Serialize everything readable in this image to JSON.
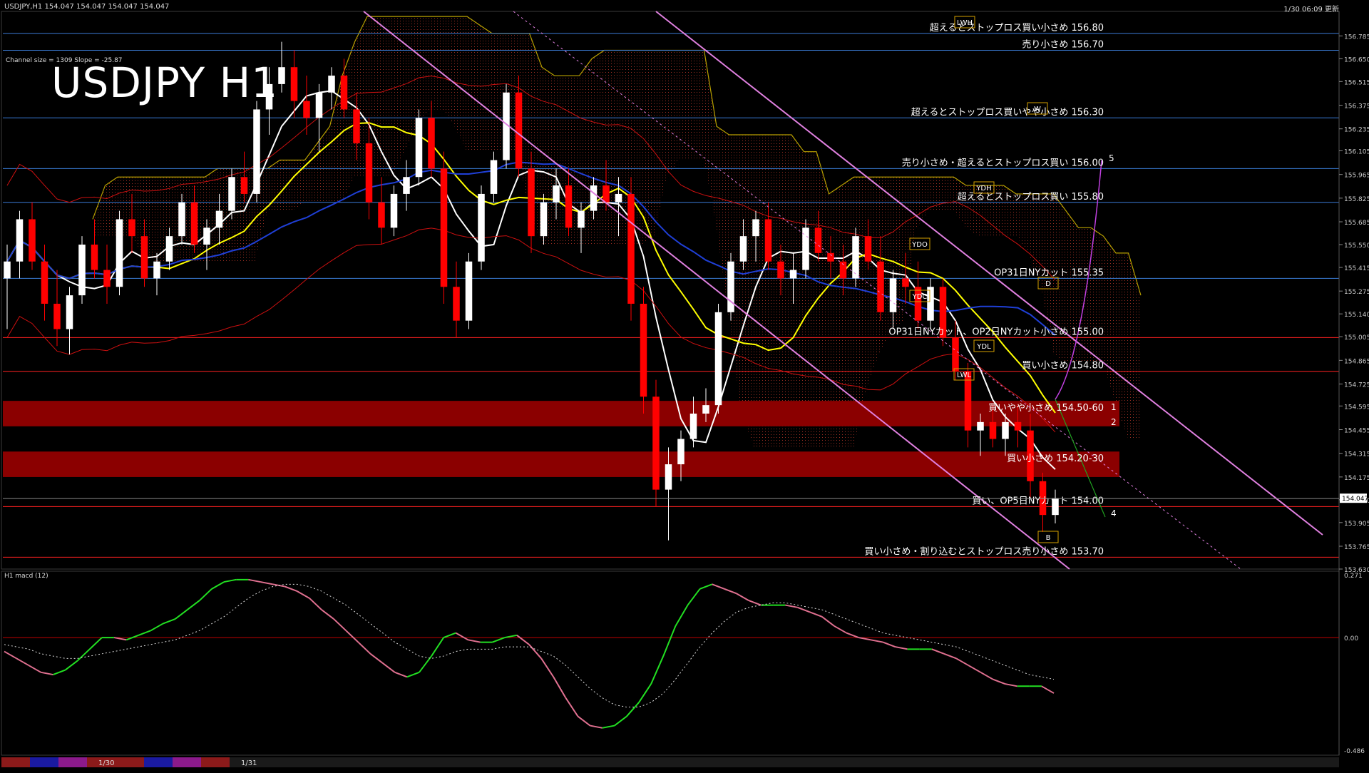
{
  "header": {
    "symbol_line": "USDJPY,H1  154.047 154.047 154.047 154.047",
    "channel_info": "Channel size = 1309 Slope = -25.87",
    "big_title": "USDJPY H1",
    "clock": "1/30 06:09 更新"
  },
  "chart_data": [
    {
      "type": "candlestick",
      "panel": "price",
      "title": "USDJPY H1",
      "ylim": [
        153.63,
        156.93
      ],
      "y_ticks": [
        "156.785",
        "156.650",
        "156.515",
        "156.375",
        "156.235",
        "156.105",
        "155.965",
        "155.825",
        "155.685",
        "155.550",
        "155.415",
        "155.275",
        "155.140",
        "155.005",
        "154.865",
        "154.725",
        "154.595",
        "154.455",
        "154.315",
        "154.175",
        "154.040",
        "153.905",
        "153.765",
        "153.630"
      ],
      "last_price": "154.047",
      "colors": {
        "up": "#ffffff",
        "down": "#ff0000",
        "grid": "#ffffff"
      },
      "candles": [
        [
          155.35,
          155.55,
          155.05,
          155.45
        ],
        [
          155.45,
          155.75,
          155.35,
          155.7
        ],
        [
          155.7,
          155.8,
          155.4,
          155.45
        ],
        [
          155.45,
          155.55,
          155.1,
          155.2
        ],
        [
          155.2,
          155.4,
          154.95,
          155.05
        ],
        [
          155.05,
          155.3,
          154.9,
          155.25
        ],
        [
          155.25,
          155.6,
          155.2,
          155.55
        ],
        [
          155.55,
          155.7,
          155.35,
          155.4
        ],
        [
          155.4,
          155.55,
          155.2,
          155.3
        ],
        [
          155.3,
          155.75,
          155.25,
          155.7
        ],
        [
          155.7,
          155.85,
          155.5,
          155.6
        ],
        [
          155.6,
          155.7,
          155.3,
          155.35
        ],
        [
          155.35,
          155.5,
          155.25,
          155.45
        ],
        [
          155.45,
          155.65,
          155.4,
          155.6
        ],
        [
          155.6,
          155.85,
          155.55,
          155.8
        ],
        [
          155.8,
          155.9,
          155.5,
          155.55
        ],
        [
          155.55,
          155.7,
          155.4,
          155.65
        ],
        [
          155.65,
          155.85,
          155.55,
          155.75
        ],
        [
          155.75,
          156.0,
          155.7,
          155.95
        ],
        [
          155.95,
          156.1,
          155.8,
          155.85
        ],
        [
          155.85,
          156.4,
          155.8,
          156.35
        ],
        [
          156.35,
          156.6,
          156.2,
          156.5
        ],
        [
          156.5,
          156.75,
          156.45,
          156.6
        ],
        [
          156.6,
          156.7,
          156.3,
          156.4
        ],
        [
          156.4,
          156.55,
          156.2,
          156.3
        ],
        [
          156.3,
          156.5,
          156.1,
          156.45
        ],
        [
          156.45,
          156.6,
          156.35,
          156.55
        ],
        [
          156.55,
          156.65,
          156.3,
          156.35
        ],
        [
          156.35,
          156.45,
          156.05,
          156.15
        ],
        [
          156.15,
          156.3,
          155.7,
          155.8
        ],
        [
          155.8,
          155.95,
          155.55,
          155.65
        ],
        [
          155.65,
          155.9,
          155.6,
          155.85
        ],
        [
          155.85,
          156.05,
          155.75,
          155.95
        ],
        [
          155.95,
          156.35,
          155.9,
          156.3
        ],
        [
          156.3,
          156.4,
          155.95,
          156.0
        ],
        [
          156.0,
          156.1,
          155.2,
          155.3
        ],
        [
          155.3,
          155.45,
          155.0,
          155.1
        ],
        [
          155.1,
          155.5,
          155.05,
          155.45
        ],
        [
          155.45,
          155.9,
          155.4,
          155.85
        ],
        [
          155.85,
          156.1,
          155.8,
          156.05
        ],
        [
          156.05,
          156.5,
          156.0,
          156.45
        ],
        [
          156.45,
          156.55,
          155.95,
          156.0
        ],
        [
          156.0,
          156.1,
          155.5,
          155.6
        ],
        [
          155.6,
          155.85,
          155.55,
          155.8
        ],
        [
          155.8,
          156.0,
          155.7,
          155.9
        ],
        [
          155.9,
          156.0,
          155.6,
          155.65
        ],
        [
          155.65,
          155.8,
          155.5,
          155.75
        ],
        [
          155.75,
          155.95,
          155.7,
          155.9
        ],
        [
          155.9,
          156.05,
          155.75,
          155.8
        ],
        [
          155.8,
          155.95,
          155.6,
          155.85
        ],
        [
          155.85,
          155.95,
          155.1,
          155.2
        ],
        [
          155.2,
          155.3,
          154.55,
          154.65
        ],
        [
          154.65,
          154.75,
          154.0,
          154.1
        ],
        [
          154.1,
          154.35,
          153.8,
          154.25
        ],
        [
          154.25,
          154.45,
          154.15,
          154.4
        ],
        [
          154.4,
          154.65,
          154.35,
          154.55
        ],
        [
          154.55,
          154.7,
          154.5,
          154.6
        ],
        [
          154.6,
          155.2,
          154.55,
          155.15
        ],
        [
          155.15,
          155.5,
          155.1,
          155.45
        ],
        [
          155.45,
          155.7,
          155.4,
          155.6
        ],
        [
          155.6,
          155.75,
          155.45,
          155.7
        ],
        [
          155.7,
          155.8,
          155.4,
          155.45
        ],
        [
          155.45,
          155.55,
          155.25,
          155.35
        ],
        [
          155.35,
          155.5,
          155.2,
          155.4
        ],
        [
          155.4,
          155.7,
          155.35,
          155.65
        ],
        [
          155.65,
          155.75,
          155.45,
          155.5
        ],
        [
          155.5,
          155.6,
          155.35,
          155.45
        ],
        [
          155.45,
          155.55,
          155.25,
          155.35
        ],
        [
          155.35,
          155.65,
          155.3,
          155.6
        ],
        [
          155.6,
          155.7,
          155.4,
          155.45
        ],
        [
          155.45,
          155.6,
          155.1,
          155.15
        ],
        [
          155.15,
          155.4,
          155.05,
          155.35
        ],
        [
          155.35,
          155.5,
          155.2,
          155.3
        ],
        [
          155.3,
          155.45,
          155.05,
          155.1
        ],
        [
          155.1,
          155.35,
          155.05,
          155.3
        ],
        [
          155.3,
          155.35,
          154.95,
          155.0
        ],
        [
          155.0,
          155.1,
          154.75,
          154.8
        ],
        [
          154.8,
          154.85,
          154.35,
          154.45
        ],
        [
          154.45,
          154.55,
          154.3,
          154.5
        ],
        [
          154.5,
          154.6,
          154.35,
          154.4
        ],
        [
          154.4,
          154.55,
          154.3,
          154.5
        ],
        [
          154.5,
          154.6,
          154.35,
          154.45
        ],
        [
          154.45,
          154.55,
          154.05,
          154.15
        ],
        [
          154.15,
          154.2,
          153.85,
          153.95
        ],
        [
          153.95,
          154.1,
          153.9,
          154.05
        ]
      ],
      "levels": [
        {
          "label": "超えるとストップロス買い小さめ 156.80",
          "price": 156.8,
          "color": "#3a7bd5"
        },
        {
          "label": "売り小さめ 156.70",
          "price": 156.7,
          "color": "#3a7bd5"
        },
        {
          "label": "超えるとストップロス買いやや小さめ 156.30",
          "price": 156.3,
          "color": "#3a7bd5"
        },
        {
          "label": "売り小さめ・超えるとストップロス買い 156.00",
          "price": 156.0,
          "color": "#3a7bd5"
        },
        {
          "label": "超えるとストップロス買い 155.80",
          "price": 155.8,
          "color": "#3a7bd5"
        },
        {
          "label": "OP31日NYカット 155.35",
          "price": 155.35,
          "color": "#3a7bd5"
        },
        {
          "label": "OP31日NYカット、OP2日NYカット小さめ 155.00",
          "price": 155.0,
          "color": "#ff2020"
        },
        {
          "label": "買い小さめ 154.80",
          "price": 154.8,
          "color": "#ff2020"
        },
        {
          "label": "買いやや小さめ 154.50-60",
          "price": 154.55,
          "color": "#ff2020",
          "band": [
            154.5,
            154.6
          ]
        },
        {
          "label": "買い小さめ 154.20-30",
          "price": 154.25,
          "color": "#ff2020",
          "band": [
            154.2,
            154.3
          ]
        },
        {
          "label": "買い、OP5日NYカット 154.00",
          "price": 154.0,
          "color": "#ff2020"
        },
        {
          "label": "買い小さめ・割り込むとストップロス売り小さめ 153.70",
          "price": 153.7,
          "color": "#ff2020"
        }
      ],
      "projection_labels": [
        "1",
        "2",
        "4",
        "5"
      ],
      "markers": [
        "LWH",
        "YDH",
        "W",
        "YDO",
        "YDC",
        "YDL",
        "LWL",
        "D",
        "B"
      ]
    },
    {
      "type": "line",
      "panel": "macd",
      "title": "H1  macd (12)",
      "ylim": [
        -0.486,
        0.271
      ],
      "y_ticks": [
        "0.271",
        "0.00",
        "-0.486"
      ],
      "series": [
        {
          "values": [
            -0.06,
            -0.09,
            -0.12,
            -0.15,
            -0.16,
            -0.14,
            -0.1,
            -0.05,
            0.0,
            0.0,
            -0.01,
            0.01,
            0.03,
            0.06,
            0.08,
            0.12,
            0.16,
            0.21,
            0.24,
            0.25,
            0.25,
            0.24,
            0.23,
            0.22,
            0.2,
            0.17,
            0.12,
            0.08,
            0.03,
            -0.02,
            -0.07,
            -0.11,
            -0.15,
            -0.17,
            -0.15,
            -0.08,
            0.0,
            0.02,
            -0.01,
            -0.02,
            -0.02,
            0.0,
            0.01,
            -0.03,
            -0.09,
            -0.17,
            -0.26,
            -0.34,
            -0.38,
            -0.39,
            -0.38,
            -0.34,
            -0.28,
            -0.2,
            -0.08,
            0.05,
            0.14,
            0.21,
            0.23,
            0.21,
            0.19,
            0.16,
            0.14,
            0.14,
            0.14,
            0.13,
            0.11,
            0.09,
            0.05,
            0.02,
            0.0,
            -0.01,
            -0.02,
            -0.04,
            -0.05,
            -0.05,
            -0.05,
            -0.07,
            -0.09,
            -0.12,
            -0.15,
            -0.18,
            -0.2,
            -0.21,
            -0.21,
            -0.21,
            -0.24
          ]
        },
        {
          "values": [
            -0.03,
            -0.04,
            -0.05,
            -0.07,
            -0.08,
            -0.09,
            -0.09,
            -0.08,
            -0.07,
            -0.06,
            -0.05,
            -0.04,
            -0.03,
            -0.02,
            -0.01,
            0.01,
            0.03,
            0.06,
            0.09,
            0.13,
            0.17,
            0.2,
            0.22,
            0.23,
            0.23,
            0.22,
            0.2,
            0.17,
            0.14,
            0.1,
            0.06,
            0.02,
            -0.02,
            -0.05,
            -0.08,
            -0.09,
            -0.08,
            -0.06,
            -0.05,
            -0.05,
            -0.05,
            -0.04,
            -0.04,
            -0.04,
            -0.06,
            -0.08,
            -0.12,
            -0.17,
            -0.22,
            -0.26,
            -0.29,
            -0.3,
            -0.3,
            -0.28,
            -0.24,
            -0.18,
            -0.11,
            -0.04,
            0.02,
            0.07,
            0.11,
            0.13,
            0.14,
            0.15,
            0.15,
            0.14,
            0.13,
            0.12,
            0.1,
            0.08,
            0.06,
            0.04,
            0.02,
            0.01,
            0.0,
            -0.01,
            -0.02,
            -0.03,
            -0.04,
            -0.06,
            -0.08,
            -0.1,
            -0.12,
            -0.14,
            -0.16,
            -0.17,
            -0.18
          ]
        }
      ]
    }
  ],
  "bottom_bar": {
    "dates": [
      "1/30",
      "1/31"
    ]
  }
}
